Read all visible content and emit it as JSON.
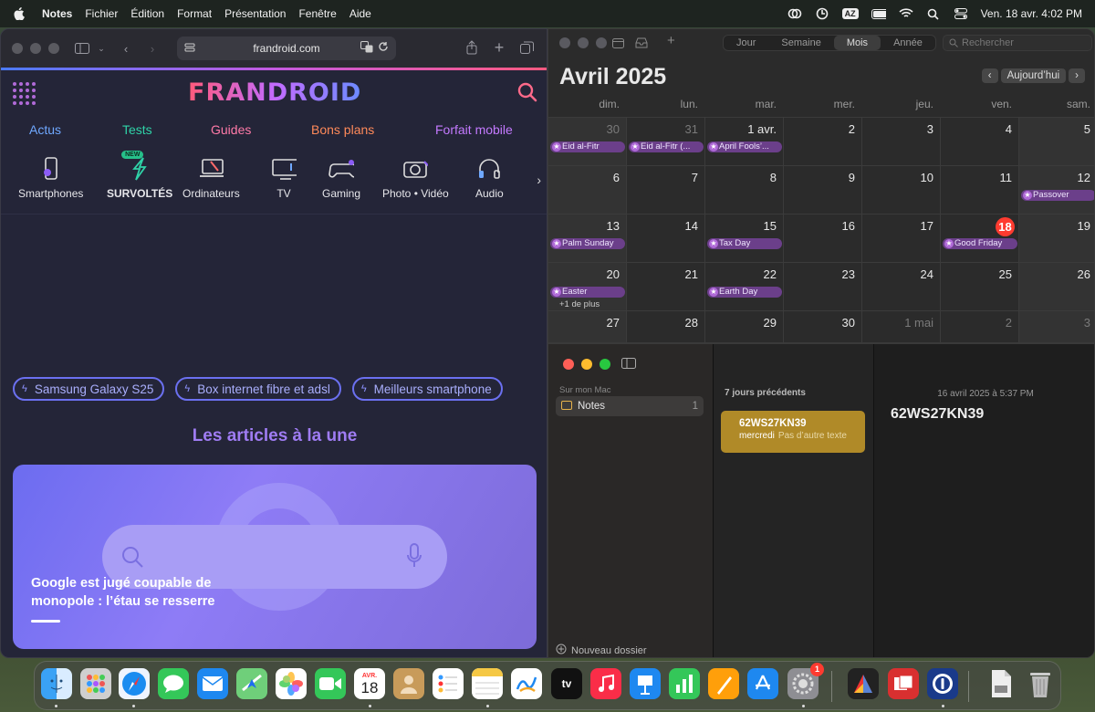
{
  "menubar": {
    "app": "Notes",
    "items": [
      "Fichier",
      "Édition",
      "Format",
      "Présentation",
      "Fenêtre",
      "Aide"
    ],
    "input_badge": "AZ",
    "clock": "Ven. 18 avr.  4:02 PM"
  },
  "safari": {
    "url": "frandroid.com",
    "site": {
      "logo": "FRANDROID",
      "nav": [
        "Actus",
        "Tests",
        "Guides",
        "Bons plans",
        "Forfait mobile"
      ],
      "nav_colors": [
        "#6fa8ff",
        "#2fd3a8",
        "#ff7aa8",
        "#ff8a5a",
        "#c47aff"
      ],
      "categories": [
        {
          "label": "Smartphones",
          "icon": "smartphone-icon"
        },
        {
          "label": "SURVOLTÉS",
          "icon": "lightning-icon",
          "badge": "NEW"
        },
        {
          "label": "Ordinateurs",
          "icon": "laptop-icon"
        },
        {
          "label": "TV",
          "icon": "tv-icon"
        },
        {
          "label": "Gaming",
          "icon": "gamepad-icon"
        },
        {
          "label": "Photo • Vidéo",
          "icon": "camera-icon"
        },
        {
          "label": "Audio",
          "icon": "headphones-icon"
        }
      ],
      "tags": [
        "Samsung Galaxy S25",
        "Box internet fibre et adsl",
        "Meilleurs smartphone"
      ],
      "section_title": "Les articles à la une",
      "featured_title": "Google est jugé coupable de monopole : l’étau se resserre"
    }
  },
  "calendar": {
    "views": [
      "Jour",
      "Semaine",
      "Mois",
      "Année"
    ],
    "active_view": "Mois",
    "search_placeholder": "Rechercher",
    "title": "Avril 2025",
    "today_button": "Aujourd’hui",
    "weekdays": [
      "dim.",
      "lun.",
      "mar.",
      "mer.",
      "jeu.",
      "ven.",
      "sam."
    ],
    "weeks": [
      [
        {
          "d": "30",
          "dim": true,
          "ev": "Eid al-Fitr"
        },
        {
          "d": "31",
          "dim": true,
          "ev": "Eid al-Fitr (..."
        },
        {
          "d": "1 avr.",
          "ev": "April Fools’..."
        },
        {
          "d": "2"
        },
        {
          "d": "3"
        },
        {
          "d": "4"
        },
        {
          "d": "5"
        }
      ],
      [
        {
          "d": "6"
        },
        {
          "d": "7"
        },
        {
          "d": "8"
        },
        {
          "d": "9"
        },
        {
          "d": "10"
        },
        {
          "d": "11"
        },
        {
          "d": "12",
          "ev": "Passover"
        }
      ],
      [
        {
          "d": "13",
          "ev": "Palm Sunday"
        },
        {
          "d": "14"
        },
        {
          "d": "15",
          "ev": "Tax Day"
        },
        {
          "d": "16"
        },
        {
          "d": "17"
        },
        {
          "d": "18",
          "today": true,
          "ev": "Good Friday"
        },
        {
          "d": "19"
        }
      ],
      [
        {
          "d": "20",
          "ev": "Easter",
          "more": "+1 de plus"
        },
        {
          "d": "21"
        },
        {
          "d": "22",
          "ev": "Earth Day"
        },
        {
          "d": "23"
        },
        {
          "d": "24"
        },
        {
          "d": "25"
        },
        {
          "d": "26"
        }
      ],
      [
        {
          "d": "27"
        },
        {
          "d": "28"
        },
        {
          "d": "29"
        },
        {
          "d": "30"
        },
        {
          "d": "1 mai",
          "dim": true
        },
        {
          "d": "2",
          "dim": true
        },
        {
          "d": "3",
          "dim": true
        }
      ]
    ]
  },
  "notes": {
    "section": "Sur mon Mac",
    "folder": {
      "name": "Notes",
      "count": "1"
    },
    "new_folder": "Nouveau dossier",
    "list_header": "7 jours précédents",
    "note": {
      "title": "62WS27KN39",
      "day": "mercredi",
      "preview": "Pas d’autre texte"
    },
    "detail_date": "16 avril 2025 à 5:37 PM",
    "detail_title": "62WS27KN39"
  },
  "dock": {
    "calendar_month": "AVR.",
    "calendar_day": "18",
    "tv_label": "tv",
    "settings_badge": "1",
    "apps": [
      "finder-icon",
      "launchpad-icon",
      "safari-icon",
      "messages-icon",
      "mail-icon",
      "maps-icon",
      "photos-icon",
      "facetime-icon",
      "calendar-icon",
      "contacts-icon",
      "reminders-icon",
      "notes-icon",
      "freeform-icon",
      "tv-icon",
      "music-icon",
      "keynote-icon",
      "numbers-icon",
      "pages-icon",
      "app-store-icon",
      "settings-icon",
      "affinity-icon",
      "photo-booth-icon",
      "1password-icon",
      "document-icon",
      "trash-icon"
    ]
  }
}
